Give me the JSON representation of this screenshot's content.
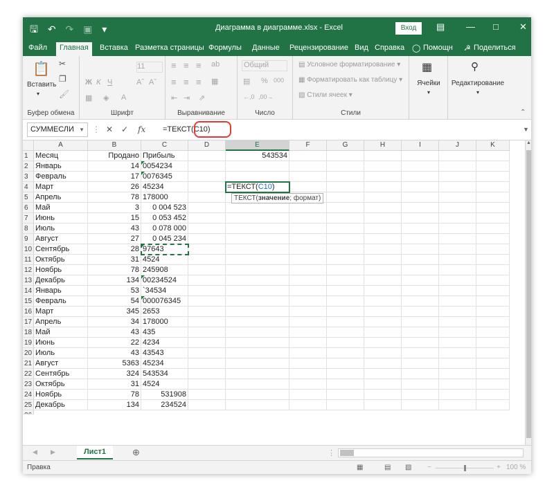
{
  "title_bar": {
    "window_title": "Диаграмма в диаграмме.xlsx - Excel",
    "sign_in": "Вход",
    "save_icon": "save-icon",
    "undo_icon": "undo-icon",
    "redo_icon": "redo-icon",
    "camera_icon": "camera-icon",
    "customize_icon": "customize-qat-icon"
  },
  "ribbon_tabs": [
    "Файл",
    "Главная",
    "Вставка",
    "Разметка страницы",
    "Формулы",
    "Данные",
    "Рецензирование",
    "Вид",
    "Справка",
    "Помощн",
    "Поделиться"
  ],
  "active_tab": "Главная",
  "ribbon": {
    "clipboard": {
      "paste": "Вставить",
      "label": "Буфер обмена"
    },
    "font": {
      "label": "Шрифт",
      "size": "11"
    },
    "alignment": {
      "label": "Выравнивание"
    },
    "number": {
      "label": "Число",
      "format": "Общий"
    },
    "styles": {
      "label": "Стили",
      "conditional": "Условное форматирование",
      "format_table": "Форматировать как таблицу",
      "cell_styles": "Стили ячеек"
    },
    "cells": {
      "label": "Ячейки"
    },
    "editing": {
      "label": "Редактирование"
    }
  },
  "formula_bar": {
    "name_box": "СУММЕСЛИ",
    "formula_prefix": "=ТЕКСТ(",
    "formula_ref": "C10",
    "formula_suffix": ")"
  },
  "columns": [
    "A",
    "B",
    "C",
    "D",
    "E",
    "F",
    "G",
    "H",
    "I",
    "J",
    "K"
  ],
  "header_row": {
    "a": "Месяц",
    "b": "Продано",
    "c": "Прибыль",
    "e": "543534"
  },
  "rows": [
    {
      "n": "2",
      "a": "Январь",
      "b": "14",
      "c": "0054234"
    },
    {
      "n": "3",
      "a": "Февраль",
      "b": "17",
      "c": "0076345"
    },
    {
      "n": "4",
      "a": "Март",
      "b": "26",
      "c": "45234"
    },
    {
      "n": "5",
      "a": "Апрель",
      "b": "78",
      "c": "178000"
    },
    {
      "n": "6",
      "a": "Май",
      "b": "3",
      "c": "0 004 523"
    },
    {
      "n": "7",
      "a": "Июнь",
      "b": "15",
      "c": "0 053 452"
    },
    {
      "n": "8",
      "a": "Июль",
      "b": "43",
      "c": "0 078 000"
    },
    {
      "n": "9",
      "a": "Август",
      "b": "27",
      "c": "0 045 234"
    },
    {
      "n": "10",
      "a": "Сентябрь",
      "b": "28",
      "c": "97643"
    },
    {
      "n": "11",
      "a": "Октябрь",
      "b": "31",
      "c": "4524"
    },
    {
      "n": "12",
      "a": "Ноябрь",
      "b": "78",
      "c": "245908"
    },
    {
      "n": "13",
      "a": "Декабрь",
      "b": "134",
      "c": "00234524"
    },
    {
      "n": "14",
      "a": "Январь",
      "b": "53",
      "c": "`34534"
    },
    {
      "n": "15",
      "a": "Февраль",
      "b": "54",
      "c": "000076345"
    },
    {
      "n": "16",
      "a": "Март",
      "b": "345",
      "c": "2653"
    },
    {
      "n": "17",
      "a": "Апрель",
      "b": "34",
      "c": "178000"
    },
    {
      "n": "18",
      "a": "Май",
      "b": "43",
      "c": "435"
    },
    {
      "n": "19",
      "a": "Июнь",
      "b": "22",
      "c": "4234"
    },
    {
      "n": "20",
      "a": "Июль",
      "b": "43",
      "c": "43543"
    },
    {
      "n": "21",
      "a": "Август",
      "b": "5363",
      "c": "45234"
    },
    {
      "n": "22",
      "a": "Сентябрь",
      "b": "324",
      "c": "543534"
    },
    {
      "n": "23",
      "a": "Октябрь",
      "b": "31",
      "c": "4524"
    },
    {
      "n": "24",
      "a": "Ноябрь",
      "b": "78",
      "c": "531908"
    },
    {
      "n": "25",
      "a": "Декабрь",
      "b": "134",
      "c": "234524"
    }
  ],
  "active_cell": {
    "prefix": "=ТЕКСТ(",
    "ref": "C10",
    "suffix": ")"
  },
  "tooltip": {
    "func": "ТЕКСТ(",
    "arg1": "значение",
    "rest": "; формат)"
  },
  "sheet_tab": "Лист1",
  "status": {
    "mode": "Правка",
    "zoom": "100 %"
  }
}
